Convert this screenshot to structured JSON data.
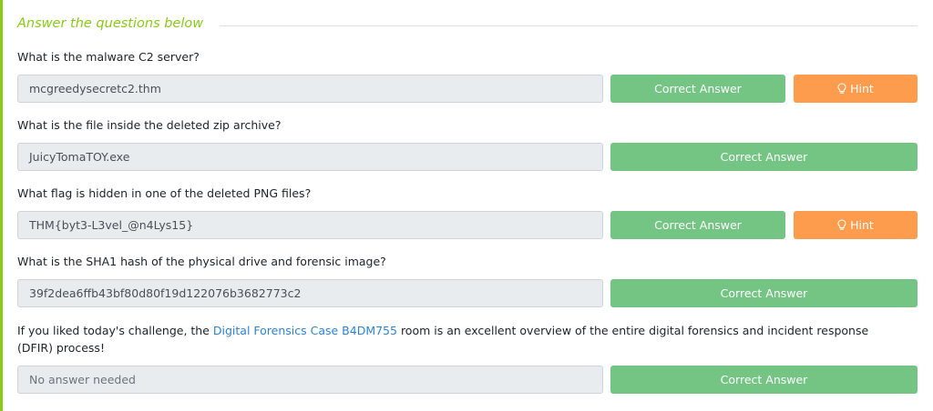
{
  "section": {
    "title": "Answer the questions below"
  },
  "questions": [
    {
      "prompt": "What is the malware C2 server?",
      "answer": "mcgreedysecretc2.thm",
      "button": "Correct Answer",
      "hint": "Hint"
    },
    {
      "prompt": "What is the file inside the deleted zip archive?",
      "answer": "JuicyTomaTOY.exe",
      "button": "Correct Answer"
    },
    {
      "prompt": "What flag is hidden in one of the deleted PNG files?",
      "answer": "THM{byt3-L3vel_@n4Lys15}",
      "button": "Correct Answer",
      "hint": "Hint"
    },
    {
      "prompt": "What is the SHA1 hash of the physical drive and forensic image?",
      "answer": "39f2dea6ffb43bf80d80f19d122076b3682773c2",
      "button": "Correct Answer"
    },
    {
      "prompt_before": "If you liked today's challenge, the ",
      "prompt_link": "Digital Forensics Case B4DM755",
      "prompt_after": " room is an excellent overview of the entire digital forensics and incident response (DFIR) process!",
      "answer_placeholder": "No answer needed",
      "button": "Correct Answer"
    }
  ],
  "colors": {
    "accent": "#88cc14",
    "correct": "#74c583",
    "hint": "#fc9c4c",
    "link": "#2c84d8"
  },
  "icons": {
    "hint": "lightbulb-icon"
  }
}
